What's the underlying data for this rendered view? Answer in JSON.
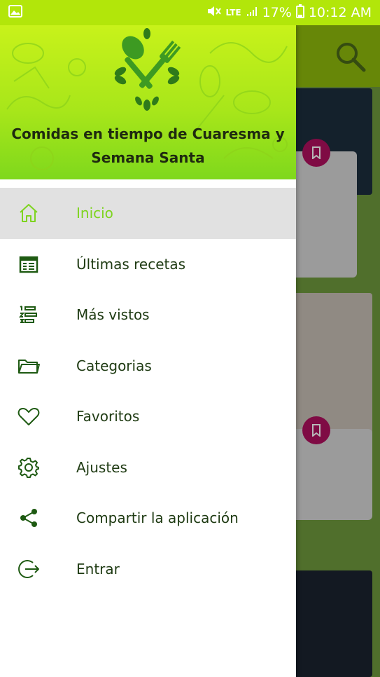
{
  "status_bar": {
    "network": "LTE",
    "battery": "17%",
    "time": "10:12 AM"
  },
  "drawer": {
    "title": "Comidas en tiempo de Cuaresma y Semana Santa",
    "menu": [
      {
        "label": "Inicio",
        "icon": "home-icon",
        "active": true
      },
      {
        "label": "Últimas recetas",
        "icon": "calendar-icon",
        "active": false
      },
      {
        "label": "Más vistos",
        "icon": "ranked-list-icon",
        "active": false
      },
      {
        "label": "Categorias",
        "icon": "folder-icon",
        "active": false
      },
      {
        "label": "Favoritos",
        "icon": "heart-icon",
        "active": false
      },
      {
        "label": "Ajustes",
        "icon": "gear-icon",
        "active": false
      },
      {
        "label": "Compartir la aplicación",
        "icon": "share-icon",
        "active": false
      },
      {
        "label": "Entrar",
        "icon": "login-icon",
        "active": false
      }
    ]
  },
  "colors": {
    "status_bar": "#b2e60a",
    "accent": "#7ed41f",
    "menu_text": "#1e3a12",
    "bookmark": "#b0105f"
  }
}
